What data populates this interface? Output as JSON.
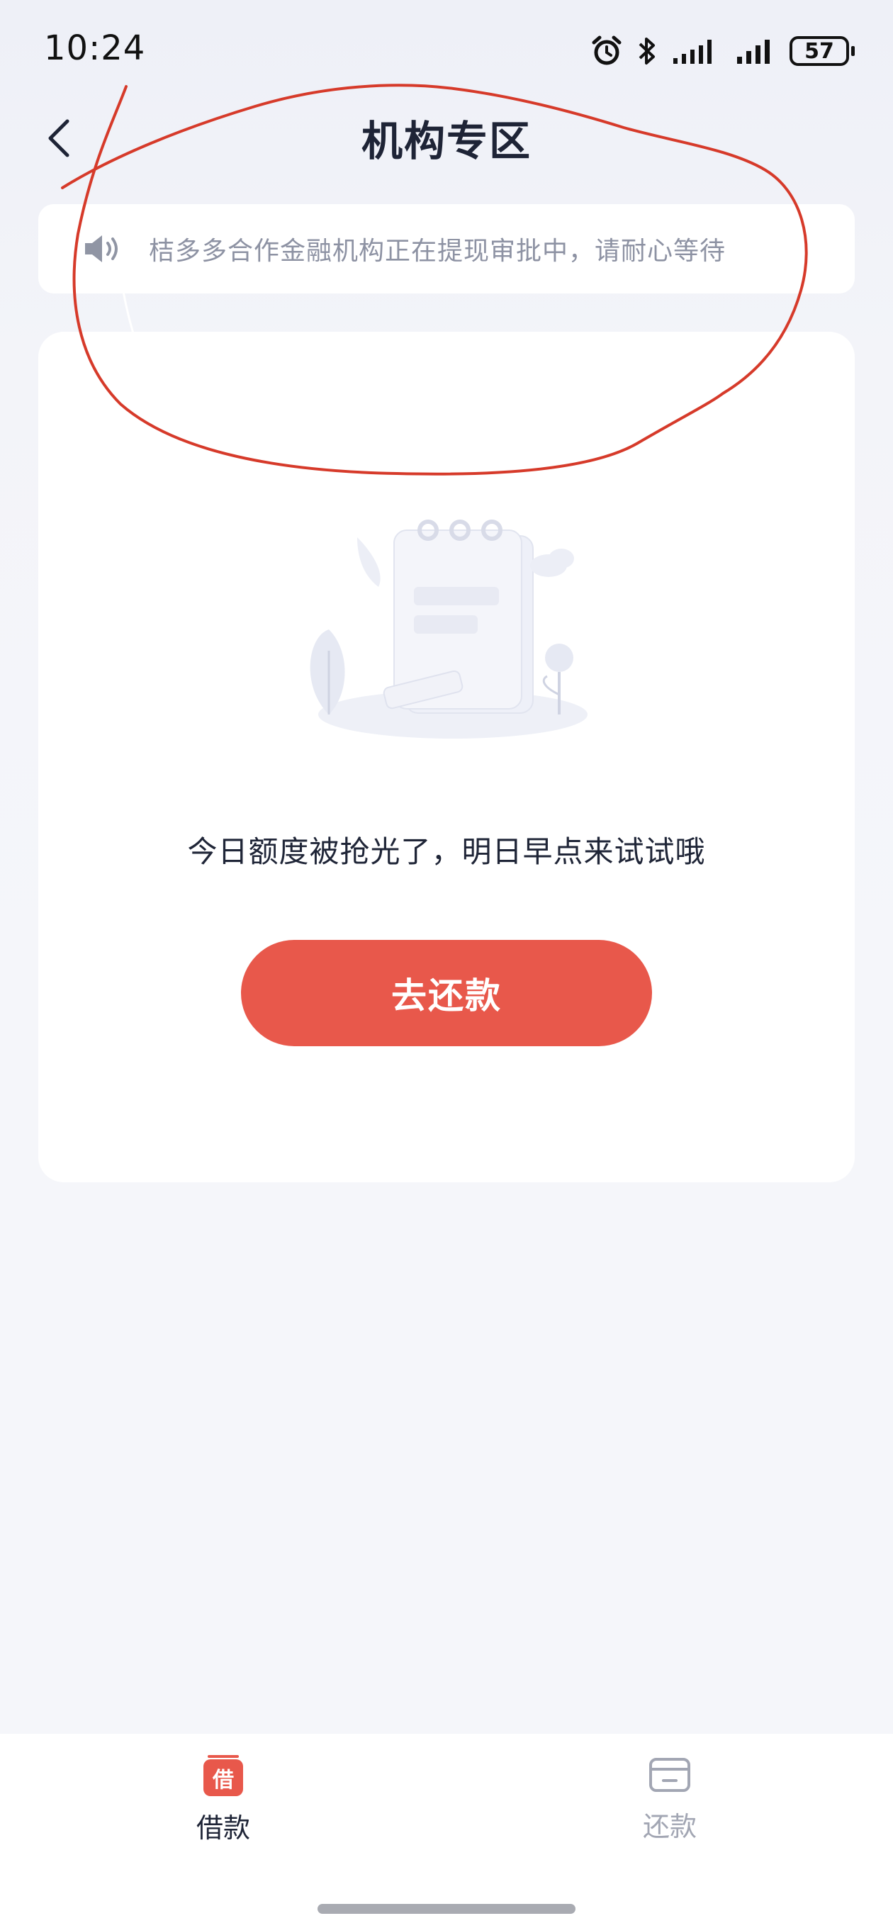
{
  "status_bar": {
    "time": "10:24",
    "battery": "57",
    "icons": [
      "alarm-icon",
      "bluetooth-icon",
      "cell-signal-icon",
      "cell-signal-icon"
    ]
  },
  "nav": {
    "title": "机构专区",
    "back_icon": "chevron-left-icon"
  },
  "notice": {
    "icon": "speaker-icon",
    "text": "桔多多合作金融机构正在提现审批中，请耐心等待"
  },
  "card": {
    "illustration": "empty-notepad-illustration",
    "message": "今日额度被抢光了，明日早点来试试哦",
    "button_label": "去还款"
  },
  "tabs": [
    {
      "label": "借款",
      "icon_text": "借",
      "active": true
    },
    {
      "label": "还款",
      "icon": "card-icon",
      "active": false
    }
  ],
  "colors": {
    "accent": "#e8584b",
    "background": "#f5f6fa",
    "annotation": "#d63a2a"
  }
}
